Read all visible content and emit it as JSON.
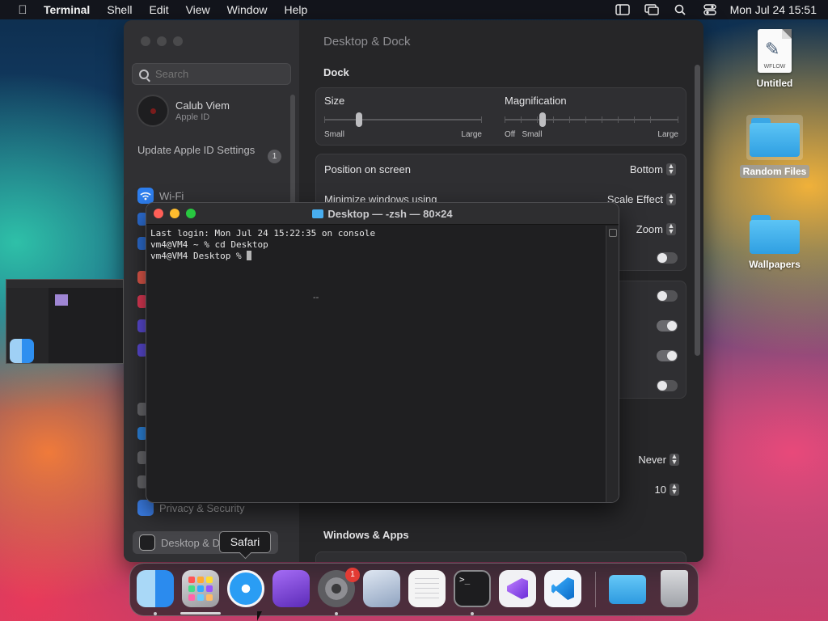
{
  "menubar": {
    "app_name": "Terminal",
    "items": [
      "Shell",
      "Edit",
      "View",
      "Window",
      "Help"
    ],
    "clock": "Mon Jul 24  15:51",
    "icons": [
      "apple-icon",
      "stage-manager-icon",
      "screen-mirroring-icon",
      "spotlight-icon",
      "control-center-icon"
    ]
  },
  "desktop": {
    "icons": [
      {
        "name": "Untitled",
        "doc_label": "WFLOW",
        "type": "workflow-document-icon"
      },
      {
        "name": "Random Files",
        "type": "folder-icon"
      },
      {
        "name": "Wallpapers",
        "type": "folder-icon"
      }
    ]
  },
  "settings": {
    "search_placeholder": "Search",
    "account_name": "Calub Viem",
    "account_sub": "Apple ID",
    "update_label": "Update Apple ID Settings",
    "update_badge": "1",
    "sidebar_items": {
      "wifi": "Wi-Fi",
      "privacy": "Privacy & Security",
      "desktop_dock": "Desktop & Dock"
    },
    "title": "Desktop & Dock",
    "dock_section": "Dock",
    "size": {
      "label": "Size",
      "min": "Small",
      "max": "Large",
      "level": 0.22
    },
    "magnification": {
      "label": "Magnification",
      "off": "Off",
      "min": "Small",
      "max": "Large",
      "level": 0.22
    },
    "rows": {
      "position_label": "Position on screen",
      "position_value": "Bottom",
      "minimize_label": "Minimize windows using",
      "minimize_value": "Scale Effect",
      "double_click_value": "Zoom",
      "never_value": "Never",
      "ten_value": "10"
    },
    "windows_section": "Windows & Apps"
  },
  "terminal": {
    "title": "Desktop — -zsh — 80×24",
    "lines": [
      "Last login: Mon Jul 24 15:22:35 on console",
      "vm4@VM4 ~ % cd Desktop",
      "vm4@VM4 Desktop % "
    ],
    "mid_text": "--"
  },
  "dock": {
    "tooltip": "Safari",
    "settings_badge": "1",
    "apps": [
      "Finder",
      "Launchpad",
      "Safari",
      "Podcasts",
      "System Settings",
      "Automator",
      "TextEdit",
      "Terminal",
      "Visual Studio",
      "Visual Studio Code",
      "Downloads",
      "Trash"
    ]
  }
}
